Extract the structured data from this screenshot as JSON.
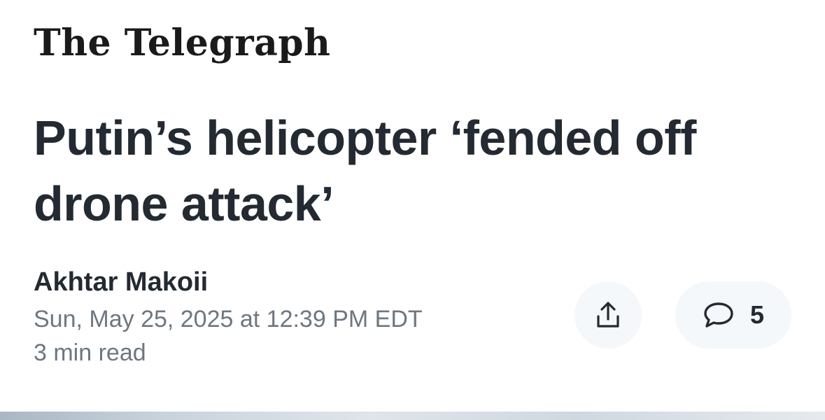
{
  "publisher": {
    "logo_text": "The Telegraph"
  },
  "article": {
    "headline": "Putin’s helicopter ‘fended off drone attack’",
    "author": "Akhtar Makoii",
    "timestamp": "Sun, May 25, 2025 at 12:39 PM EDT",
    "read_time": "3 min read"
  },
  "actions": {
    "share_icon": "share-icon",
    "comment_icon": "comment-icon",
    "comment_count": "5"
  },
  "colors": {
    "text_primary": "#232a31",
    "text_secondary": "#6e7780",
    "button_bg": "#f5f8fa"
  }
}
